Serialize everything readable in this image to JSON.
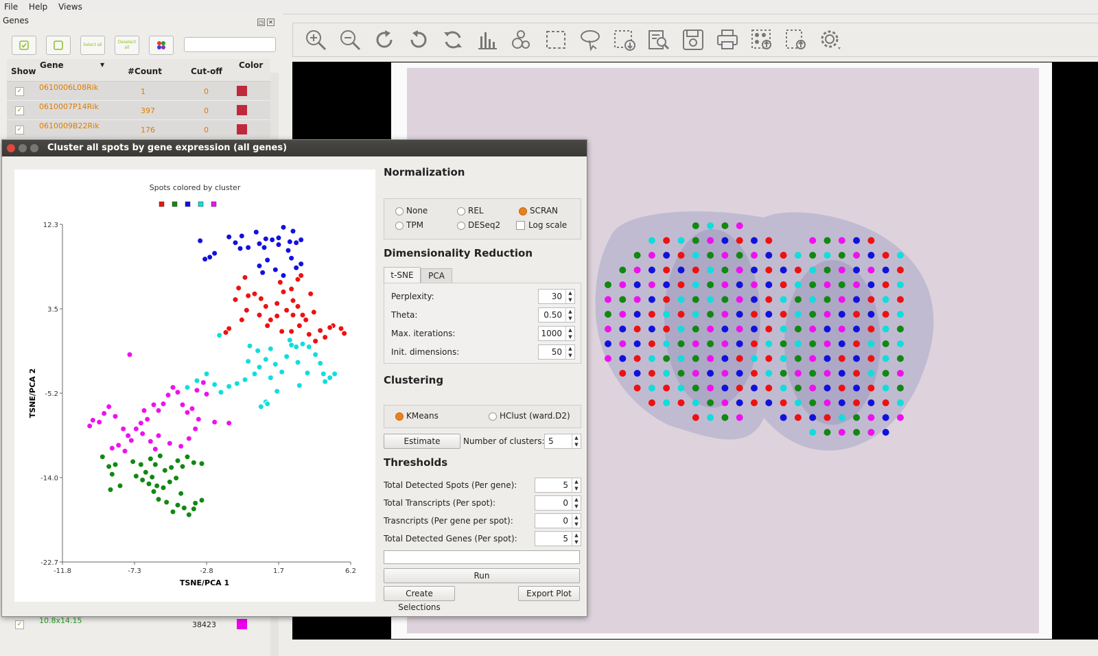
{
  "menubar": {
    "items": [
      "File",
      "Help",
      "Views"
    ]
  },
  "genes_dock": {
    "title": "Genes",
    "buttons": {
      "select_all": "Select all",
      "deselect_all": "Deselect all"
    },
    "columns": [
      "Show",
      "Gene",
      "#Count",
      "Cut-off",
      "Color"
    ],
    "rows": [
      {
        "gene": "0610006L08Rik",
        "count": "1",
        "cutoff": "0",
        "color": "#c0283c"
      },
      {
        "gene": "0610007P14Rik",
        "count": "397",
        "cutoff": "0",
        "color": "#c0283c"
      },
      {
        "gene": "0610009B22Rik",
        "count": "176",
        "cutoff": "0",
        "color": "#c0283c"
      }
    ],
    "bottom_row": {
      "gene": "10.8x14.15",
      "count": "38423",
      "color": "#ee00ee"
    }
  },
  "dialog": {
    "title": "Cluster all spots by gene expression (all genes)",
    "normalization": {
      "heading": "Normalization",
      "options": [
        "None",
        "REL",
        "SCRAN",
        "TPM",
        "DESeq2"
      ],
      "selected": "SCRAN",
      "log_scale_label": "Log scale"
    },
    "dim_reduction": {
      "heading": "Dimensionality Reduction",
      "tabs": [
        "t-SNE",
        "PCA"
      ],
      "active_tab": "t-SNE",
      "params": [
        {
          "label": "Perplexity:",
          "value": "30"
        },
        {
          "label": "Theta:",
          "value": "0.50"
        },
        {
          "label": "Max. iterations:",
          "value": "1000"
        },
        {
          "label": "Init. dimensions:",
          "value": "50"
        }
      ]
    },
    "clustering": {
      "heading": "Clustering",
      "methods": [
        "KMeans",
        "HClust (ward.D2)"
      ],
      "selected": "KMeans",
      "estimate_label": "Estimate",
      "num_clusters_label": "Number of clusters:",
      "num_clusters": "5"
    },
    "thresholds": {
      "heading": "Thresholds",
      "items": [
        {
          "label": "Total Detected Spots (Per gene):",
          "value": "5"
        },
        {
          "label": "Total Transcripts (Per spot):",
          "value": "0"
        },
        {
          "label": "Trasncripts (Per gene per spot):",
          "value": "0"
        },
        {
          "label": "Total Detected Genes (Per spot):",
          "value": "5"
        }
      ]
    },
    "run_label": "Run",
    "create_selections_label": "Create Selections",
    "export_plot_label": "Export Plot"
  },
  "chart_data": {
    "type": "scatter",
    "title": "Spots colored by cluster",
    "xlabel": "TSNE/PCA 1",
    "ylabel": "TSNE/PCA 2",
    "xlim": [
      -11.8,
      6.2
    ],
    "ylim": [
      -22.7,
      12.3
    ],
    "xticks": [
      "-11.8",
      "-7.3",
      "-2.8",
      "1.7",
      "6.2"
    ],
    "yticks": [
      "12.3",
      "3.5",
      "-5.2",
      "-14.0",
      "-22.7"
    ],
    "legend_colors": [
      "#ee1111",
      "#118811",
      "#1111dd",
      "#11dddd",
      "#ee11ee"
    ],
    "series": [
      {
        "color": "#1111dd",
        "points": [
          [
            -3.2,
            10.6
          ],
          [
            -2.3,
            9.3
          ],
          [
            -2.6,
            8.9
          ],
          [
            -2.9,
            8.7
          ],
          [
            -1.4,
            11.0
          ],
          [
            -0.6,
            11.1
          ],
          [
            -1.0,
            10.4
          ],
          [
            -0.7,
            9.8
          ],
          [
            -0.2,
            9.9
          ],
          [
            0.3,
            11.5
          ],
          [
            0.5,
            10.3
          ],
          [
            0.8,
            9.9
          ],
          [
            1.3,
            10.7
          ],
          [
            1.7,
            10.9
          ],
          [
            2.0,
            12.0
          ],
          [
            2.4,
            10.5
          ],
          [
            2.6,
            11.6
          ],
          [
            2.8,
            10.4
          ],
          [
            2.3,
            9.6
          ],
          [
            0.5,
            8.0
          ],
          [
            0.7,
            7.3
          ],
          [
            1.5,
            7.6
          ],
          [
            2.0,
            7.0
          ],
          [
            2.8,
            7.8
          ],
          [
            3.1,
            8.2
          ],
          [
            1.0,
            8.6
          ],
          [
            2.5,
            8.8
          ],
          [
            1.7,
            10.2
          ],
          [
            0.9,
            10.8
          ],
          [
            3.1,
            10.7
          ]
        ]
      },
      {
        "color": "#ee1111",
        "points": [
          [
            -0.4,
            6.8
          ],
          [
            -0.8,
            5.7
          ],
          [
            -0.2,
            4.9
          ],
          [
            -1.0,
            4.5
          ],
          [
            -0.3,
            3.4
          ],
          [
            -0.6,
            2.4
          ],
          [
            -1.4,
            1.5
          ],
          [
            -1.6,
            1.1
          ],
          [
            0.2,
            5.1
          ],
          [
            0.6,
            4.6
          ],
          [
            0.9,
            3.8
          ],
          [
            0.5,
            2.9
          ],
          [
            1.0,
            1.8
          ],
          [
            1.2,
            2.4
          ],
          [
            1.6,
            4.1
          ],
          [
            1.8,
            6.3
          ],
          [
            2.0,
            5.3
          ],
          [
            2.5,
            5.6
          ],
          [
            2.9,
            6.6
          ],
          [
            3.1,
            7.0
          ],
          [
            2.6,
            4.4
          ],
          [
            2.9,
            3.8
          ],
          [
            3.2,
            2.9
          ],
          [
            3.7,
            5.1
          ],
          [
            3.0,
            1.8
          ],
          [
            2.5,
            1.2
          ],
          [
            4.0,
            0.2
          ],
          [
            4.3,
            1.3
          ],
          [
            4.6,
            0.6
          ],
          [
            5.1,
            1.8
          ],
          [
            5.6,
            1.5
          ],
          [
            5.8,
            1.0
          ],
          [
            4.9,
            1.6
          ],
          [
            3.6,
            0.9
          ],
          [
            3.4,
            2.4
          ],
          [
            2.2,
            3.4
          ],
          [
            1.6,
            2.8
          ],
          [
            1.9,
            1.2
          ],
          [
            2.6,
            2.9
          ],
          [
            3.9,
            3.2
          ]
        ]
      },
      {
        "color": "#11dddd",
        "points": [
          [
            -2.0,
            0.8
          ],
          [
            -2.8,
            -3.2
          ],
          [
            -3.4,
            -3.9
          ],
          [
            -4.0,
            -4.6
          ],
          [
            -2.3,
            -4.3
          ],
          [
            -1.9,
            -5.1
          ],
          [
            -1.4,
            -4.5
          ],
          [
            -0.9,
            -4.2
          ],
          [
            -0.4,
            -3.8
          ],
          [
            0.2,
            -3.2
          ],
          [
            0.5,
            -2.5
          ],
          [
            0.9,
            -1.7
          ],
          [
            1.2,
            -0.6
          ],
          [
            0.4,
            -0.8
          ],
          [
            -0.2,
            -1.9
          ],
          [
            1.5,
            -2.2
          ],
          [
            1.9,
            -3.0
          ],
          [
            2.2,
            -1.4
          ],
          [
            2.5,
            -0.2
          ],
          [
            2.8,
            -0.4
          ],
          [
            3.2,
            -0.1
          ],
          [
            3.6,
            -0.4
          ],
          [
            4.0,
            -1.2
          ],
          [
            4.3,
            -2.1
          ],
          [
            4.5,
            -3.2
          ],
          [
            4.9,
            -3.6
          ],
          [
            5.2,
            -3.2
          ],
          [
            4.6,
            -4.0
          ],
          [
            3.5,
            -3.1
          ],
          [
            2.9,
            -2.0
          ],
          [
            1.6,
            -5.0
          ],
          [
            0.9,
            -6.1
          ],
          [
            0.6,
            -6.6
          ],
          [
            1.0,
            -6.3
          ],
          [
            -0.1,
            -0.3
          ],
          [
            2.4,
            0.3
          ],
          [
            3.0,
            -4.4
          ],
          [
            1.2,
            -3.6
          ]
        ]
      },
      {
        "color": "#ee11ee",
        "points": [
          [
            -7.6,
            -1.2
          ],
          [
            -9.9,
            -8.0
          ],
          [
            -10.1,
            -8.6
          ],
          [
            -9.5,
            -8.2
          ],
          [
            -9.2,
            -7.3
          ],
          [
            -8.9,
            -6.6
          ],
          [
            -8.5,
            -7.6
          ],
          [
            -8.0,
            -8.9
          ],
          [
            -7.7,
            -9.6
          ],
          [
            -7.2,
            -8.9
          ],
          [
            -6.9,
            -8.3
          ],
          [
            -6.5,
            -7.9
          ],
          [
            -6.1,
            -6.4
          ],
          [
            -5.8,
            -7.0
          ],
          [
            -5.5,
            -6.3
          ],
          [
            -5.2,
            -5.4
          ],
          [
            -4.9,
            -4.6
          ],
          [
            -4.6,
            -5.1
          ],
          [
            -4.3,
            -6.4
          ],
          [
            -4.0,
            -7.2
          ],
          [
            -3.7,
            -6.8
          ],
          [
            -3.4,
            -4.9
          ],
          [
            -3.0,
            -4.1
          ],
          [
            -2.8,
            -5.3
          ],
          [
            -3.3,
            -7.9
          ],
          [
            -3.5,
            -8.9
          ],
          [
            -3.9,
            -9.9
          ],
          [
            -4.4,
            -10.7
          ],
          [
            -5.1,
            -10.4
          ],
          [
            -5.8,
            -9.6
          ],
          [
            -6.3,
            -10.2
          ],
          [
            -6.8,
            -9.4
          ],
          [
            -7.5,
            -10.1
          ],
          [
            -8.3,
            -10.6
          ],
          [
            -7.9,
            -11.2
          ],
          [
            -6.0,
            -11.0
          ],
          [
            -2.3,
            -8.2
          ],
          [
            -1.4,
            -8.3
          ],
          [
            -6.7,
            -7.0
          ],
          [
            -8.7,
            -10.9
          ]
        ]
      },
      {
        "color": "#118811",
        "points": [
          [
            -9.3,
            -11.8
          ],
          [
            -8.9,
            -12.8
          ],
          [
            -8.5,
            -12.6
          ],
          [
            -8.7,
            -13.6
          ],
          [
            -8.2,
            -14.8
          ],
          [
            -8.8,
            -15.2
          ],
          [
            -7.4,
            -12.3
          ],
          [
            -7.2,
            -13.8
          ],
          [
            -6.9,
            -12.6
          ],
          [
            -6.6,
            -13.4
          ],
          [
            -6.3,
            -12.0
          ],
          [
            -6.0,
            -12.6
          ],
          [
            -5.7,
            -11.7
          ],
          [
            -5.4,
            -13.2
          ],
          [
            -5.0,
            -12.9
          ],
          [
            -4.6,
            -12.2
          ],
          [
            -4.3,
            -12.8
          ],
          [
            -4.0,
            -11.8
          ],
          [
            -3.6,
            -12.4
          ],
          [
            -3.1,
            -12.5
          ],
          [
            -6.8,
            -14.2
          ],
          [
            -6.4,
            -14.6
          ],
          [
            -6.1,
            -15.4
          ],
          [
            -5.8,
            -16.2
          ],
          [
            -5.5,
            -15.0
          ],
          [
            -5.1,
            -14.4
          ],
          [
            -4.7,
            -14.0
          ],
          [
            -4.4,
            -15.6
          ],
          [
            -4.6,
            -16.8
          ],
          [
            -4.2,
            -17.1
          ],
          [
            -3.9,
            -17.8
          ],
          [
            -3.6,
            -17.2
          ],
          [
            -3.1,
            -16.3
          ],
          [
            -3.5,
            -16.6
          ],
          [
            -5.3,
            -16.5
          ],
          [
            -4.9,
            -17.5
          ],
          [
            -6.2,
            -13.9
          ],
          [
            -5.9,
            -14.8
          ]
        ]
      }
    ]
  },
  "tissue": {
    "colors": [
      "#ee1111",
      "#118811",
      "#1111dd",
      "#11dddd",
      "#ee11ee"
    ]
  }
}
